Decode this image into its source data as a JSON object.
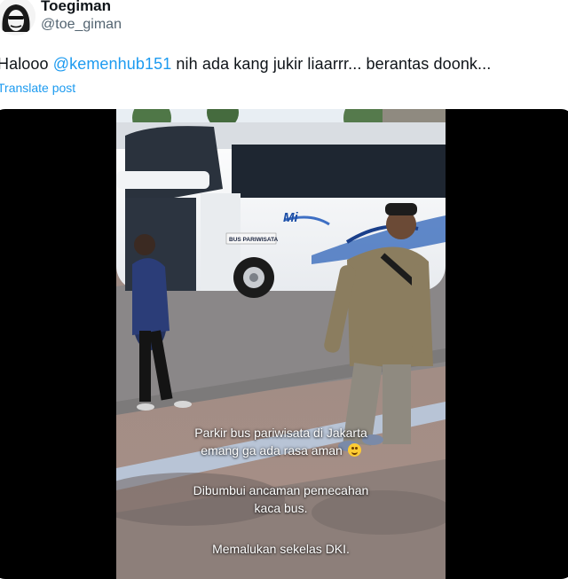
{
  "post": {
    "author_name": "Toegiman",
    "author_handle": "@toe_giman",
    "text_before": "Halooo ",
    "mention": "@kemenhub151",
    "text_after": " nih ada kang jukir liaarrr... berantas doonk...",
    "translate_label": "Translate post"
  },
  "video": {
    "bus_logo_text": "Mi",
    "bus_label": "BUS PARIWISATA",
    "caption_line1": "Parkir bus pariwisata di Jakarta",
    "caption_line2": "emang ga ada rasa aman",
    "caption_line3": "Dibumbui ancaman pemecahan",
    "caption_line4": "kaca bus.",
    "caption_line5": "Memalukan sekelas DKI.",
    "emoji": "smiling-face-emoji"
  },
  "colors": {
    "link": "#1d9bf0",
    "text": "#0f1419",
    "secondary": "#536471",
    "media_bg": "#000000"
  }
}
